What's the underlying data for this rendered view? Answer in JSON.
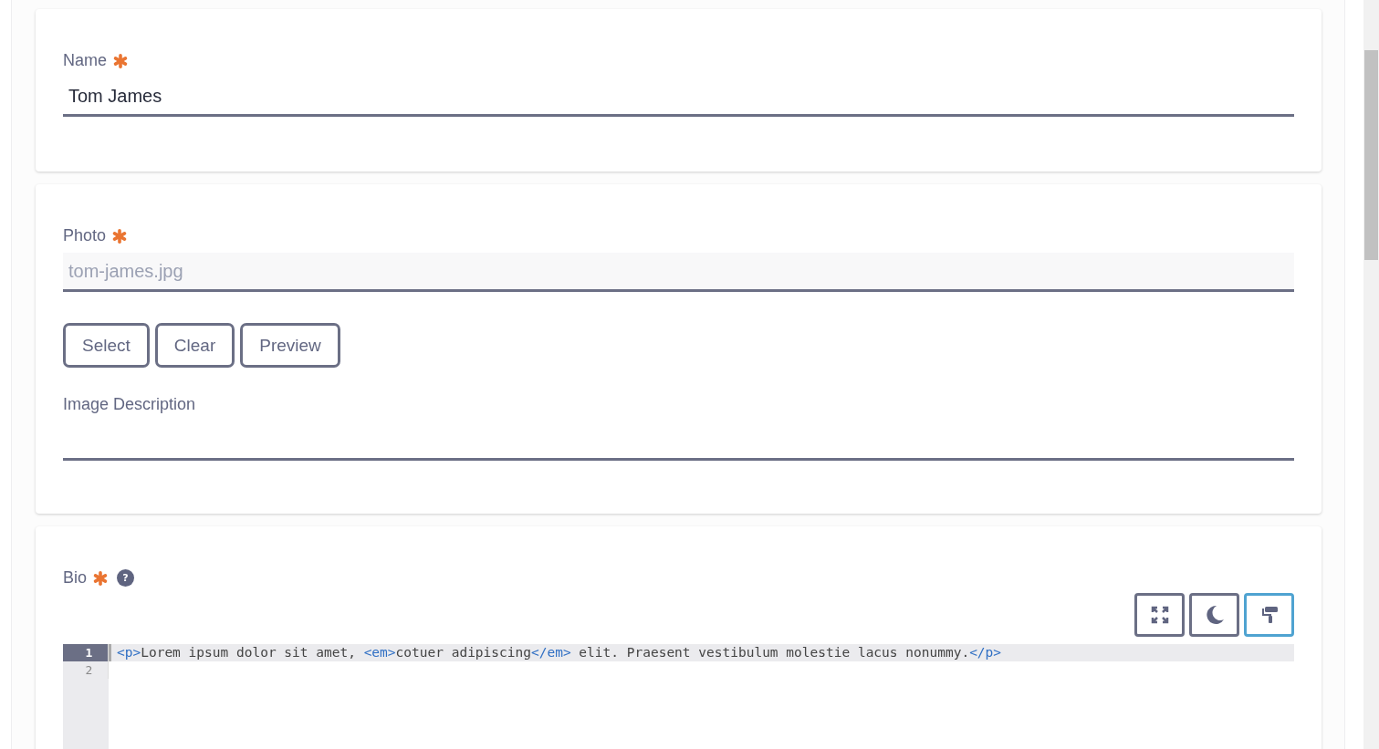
{
  "name_field": {
    "label": "Name",
    "required": true,
    "value": "Tom James"
  },
  "photo_field": {
    "label": "Photo",
    "required": true,
    "value": "tom-james.jpg",
    "readonly": true,
    "buttons": [
      "Select",
      "Clear",
      "Preview"
    ],
    "description": {
      "label": "Image Description"
    }
  },
  "bio_field": {
    "label": "Bio",
    "required": true,
    "help": "?",
    "toolbar": [
      {
        "kind": "fullscreen",
        "selected": false
      },
      {
        "kind": "dark-mode",
        "selected": false
      },
      {
        "kind": "format",
        "selected": true
      }
    ],
    "editor": {
      "lines": [
        {
          "number": "1",
          "active": true,
          "tokens": [
            {
              "kind": "tag",
              "text": "<p>"
            },
            {
              "kind": "text",
              "text": "Lorem ipsum dolor sit amet, "
            },
            {
              "kind": "tag",
              "text": "<em>"
            },
            {
              "kind": "text",
              "text": "cotuer adipiscing"
            },
            {
              "kind": "tag",
              "text": "</em>"
            },
            {
              "kind": "text",
              "text": " elit. Praesent vestibulum molestie lacus nonummy."
            },
            {
              "kind": "tag",
              "text": "</p>"
            }
          ]
        },
        {
          "number": "2",
          "active": false
        }
      ]
    }
  }
}
